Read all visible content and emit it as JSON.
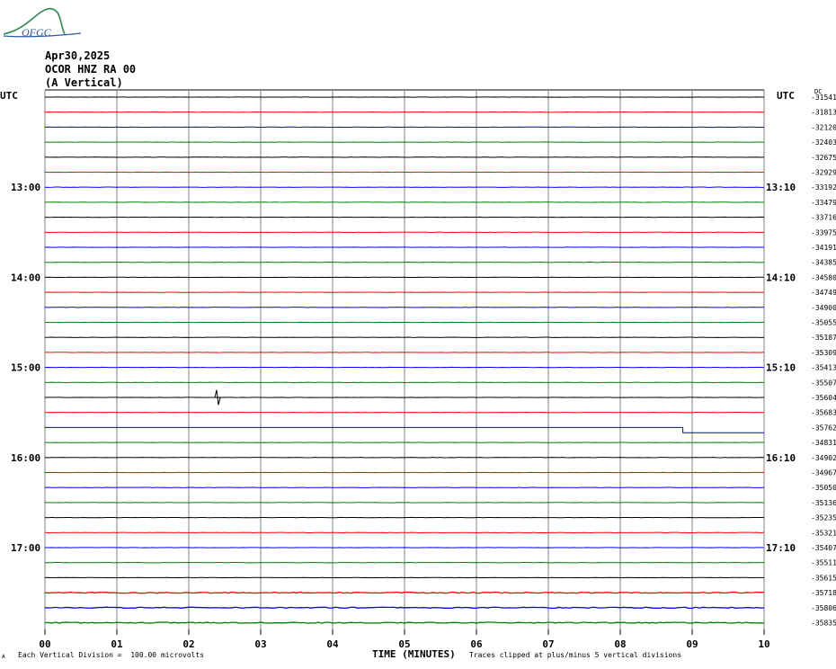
{
  "logo": {
    "text": "OFGC"
  },
  "header": {
    "date": "Apr30,2025",
    "station": "OCOR HNZ RA 00",
    "component": "(A Vertical)"
  },
  "left_axis_title": "UTC",
  "right_axis_title": "UTC",
  "right_units": "DC",
  "footer": {
    "scale_note": "Each Vertical Division =  100.00 microvolts",
    "xlabel": "TIME (MINUTES)",
    "clip_note": "Traces clipped at plus/minus 5 vertical divisions",
    "corner_mark": "A"
  },
  "colors": {
    "black": "#000000",
    "red": "#ff0000",
    "blue": "#0000ff",
    "green": "#008000",
    "grid": "#808080"
  },
  "chart_data": {
    "type": "line",
    "title": "OCOR HNZ RA 00",
    "xlabel": "TIME (MINUTES)",
    "ylabel": "UTC",
    "xlim": [
      0,
      10
    ],
    "x_ticks": [
      "00",
      "01",
      "02",
      "03",
      "04",
      "05",
      "06",
      "07",
      "08",
      "09",
      "10"
    ],
    "left_time_labels": [
      {
        "row": 6,
        "label": "13:00"
      },
      {
        "row": 12,
        "label": "14:00"
      },
      {
        "row": 18,
        "label": "15:00"
      },
      {
        "row": 24,
        "label": "16:00"
      },
      {
        "row": 30,
        "label": "17:00"
      }
    ],
    "right_time_labels": [
      {
        "row": 6,
        "label": "13:10"
      },
      {
        "row": 12,
        "label": "14:10"
      },
      {
        "row": 18,
        "label": "15:10"
      },
      {
        "row": 24,
        "label": "16:10"
      },
      {
        "row": 30,
        "label": "17:10"
      }
    ],
    "trace_colors": [
      "black",
      "red",
      "blue",
      "green"
    ],
    "dc_offsets": [
      "-31541",
      "-31813",
      "-32120",
      "-32403",
      "-32675",
      "-32929",
      "-33192",
      "-33479",
      "-33716",
      "-33975",
      "-34191",
      "-34385",
      "-34580",
      "-34749",
      "-34900",
      "-35055",
      "-35187",
      "-35309",
      "-35413",
      "-35507",
      "-35604",
      "-35683",
      "-35762",
      "-34831",
      "-34902",
      "-34967",
      "-35050",
      "-35136",
      "-35235",
      "-35321",
      "-35407",
      "-35511",
      "-35615",
      "-35718",
      "-35806",
      "-35835"
    ],
    "events": [
      {
        "row": 20,
        "minute": 2.4,
        "amplitude": 0.5,
        "kind": "spike"
      },
      {
        "row": 22,
        "minute": 8.87,
        "amplitude": -0.35,
        "kind": "step"
      }
    ],
    "grid": true
  }
}
